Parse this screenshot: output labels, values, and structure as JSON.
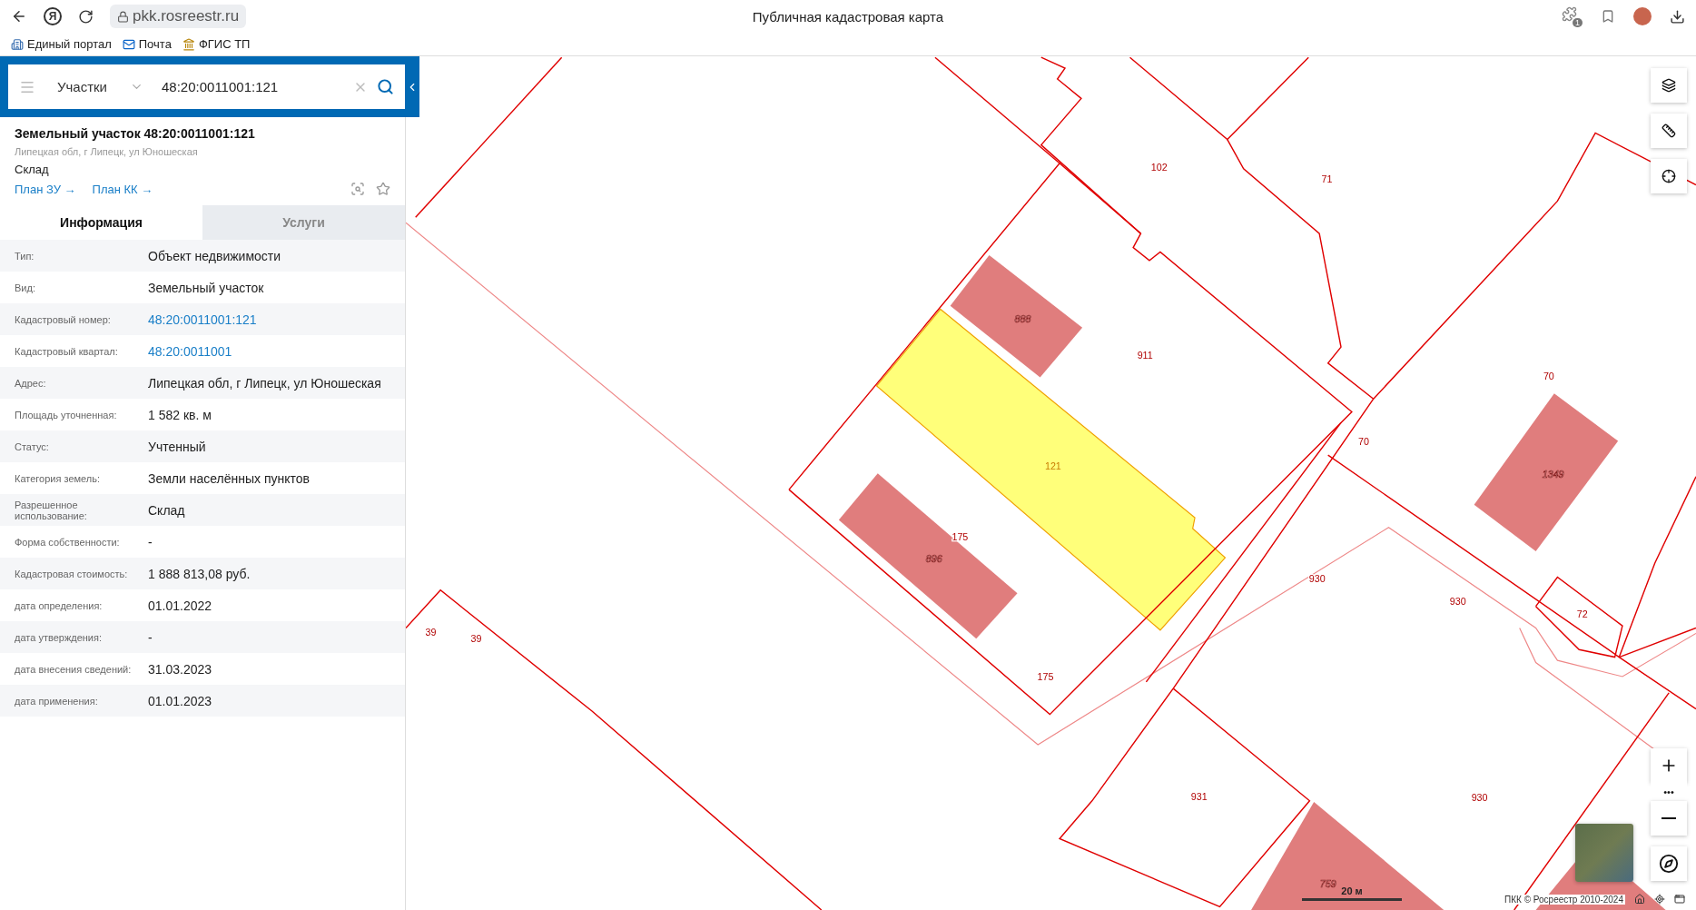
{
  "browser": {
    "logo": "Я",
    "address": "pkk.rosreestr.ru",
    "title": "Публичная кадастровая карта",
    "extension_badge": "1",
    "bookmarks": [
      {
        "label": "Единый портал"
      },
      {
        "label": "Почта"
      },
      {
        "label": "ФГИС ТП"
      }
    ]
  },
  "search": {
    "layer": "Участки",
    "value": "48:20:0011001:121"
  },
  "card": {
    "title": "Земельный участок 48:20:0011001:121",
    "address": "Липецкая обл, г Липецк, ул Юношеская",
    "usage": "Склад",
    "links": [
      {
        "label": "План ЗУ →"
      },
      {
        "label": "План КК →"
      }
    ]
  },
  "tabs": [
    {
      "label": "Информация",
      "selected": true
    },
    {
      "label": "Услуги",
      "selected": false
    }
  ],
  "rows": [
    {
      "label": "Тип:",
      "value": "Объект недвижимости",
      "kind": "text"
    },
    {
      "label": "Вид:",
      "value": "Земельный участок",
      "kind": "text"
    },
    {
      "label": "Кадастровый номер:",
      "value": "48:20:0011001:121",
      "kind": "link"
    },
    {
      "label": "Кадастровый квартал:",
      "value": "48:20:0011001",
      "kind": "link"
    },
    {
      "label": "Адрес:",
      "value": "Липецкая обл, г Липецк, ул Юношеская",
      "kind": "text"
    },
    {
      "label": "Площадь уточненная:",
      "value": "1 582 кв. м",
      "kind": "text"
    },
    {
      "label": "Статус:",
      "value": "Учтенный",
      "kind": "text"
    },
    {
      "label": "Категория земель:",
      "value": "Земли населённых пунктов",
      "kind": "text"
    },
    {
      "label": "Разрешенное использование:",
      "value": "Склад",
      "kind": "text"
    },
    {
      "label": "Форма собственности:",
      "value": "-",
      "kind": "text"
    },
    {
      "label": "Кадастровая стоимость:",
      "value": "1 888 813,08 руб.",
      "kind": "text"
    },
    {
      "label": "дата определения:",
      "value": "01.01.2022",
      "kind": "text"
    },
    {
      "label": "дата утверждения:",
      "value": "-",
      "kind": "text"
    },
    {
      "label": "дата внесения сведений:",
      "value": "31.03.2023",
      "kind": "text"
    },
    {
      "label": "дата применения:",
      "value": "01.01.2023",
      "kind": "text"
    }
  ],
  "map": {
    "labels": [
      {
        "text": "102",
        "kind": "parcel"
      },
      {
        "text": "71",
        "kind": "parcel"
      },
      {
        "text": "911",
        "kind": "parcel"
      },
      {
        "text": "70",
        "kind": "parcel"
      },
      {
        "text": "70",
        "kind": "parcel"
      },
      {
        "text": "121",
        "kind": "selected"
      },
      {
        "text": "888",
        "kind": "building"
      },
      {
        "text": "175",
        "kind": "parcel"
      },
      {
        "text": "896",
        "kind": "building"
      },
      {
        "text": "930",
        "kind": "parcel"
      },
      {
        "text": "930",
        "kind": "parcel"
      },
      {
        "text": "72",
        "kind": "parcel"
      },
      {
        "text": "1349",
        "kind": "building"
      },
      {
        "text": "39",
        "kind": "parcel"
      },
      {
        "text": "39",
        "kind": "parcel"
      },
      {
        "text": "175",
        "kind": "parcel"
      },
      {
        "text": "931",
        "kind": "parcel"
      },
      {
        "text": "930",
        "kind": "parcel"
      },
      {
        "text": "759",
        "kind": "building"
      }
    ],
    "zoom_more": "•••",
    "scale": "20 м",
    "copyright": "ПКК © Росреестр 2010-2024"
  }
}
